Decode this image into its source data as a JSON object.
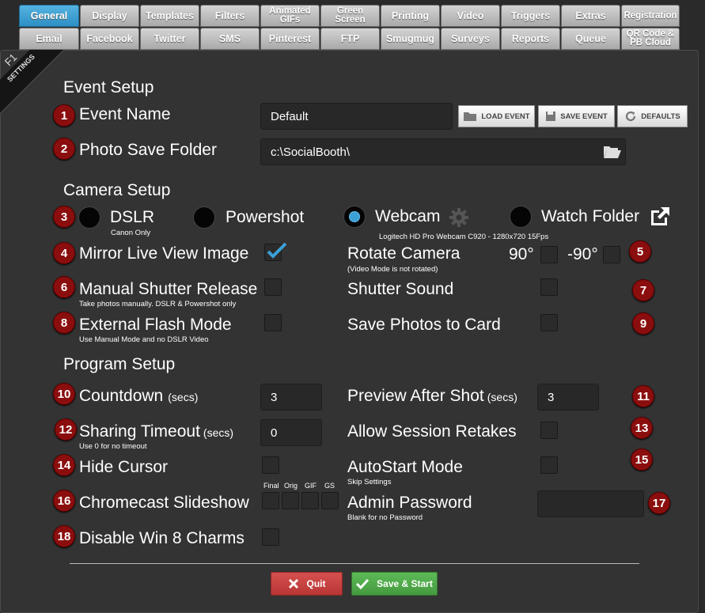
{
  "tabs_row1": [
    "General",
    "Display",
    "Templates",
    "Filters",
    "Animated GIFs",
    "Green Screen",
    "Printing",
    "Video",
    "Triggers",
    "Extras",
    "Registration"
  ],
  "tabs_row2": [
    "Email",
    "Facebook",
    "Twitter",
    "SMS",
    "Pinterest",
    "FTP",
    "Smugmug",
    "Surveys",
    "Reports",
    "Queue",
    "QR Code & PB Cloud"
  ],
  "ribbon": {
    "key": "F1",
    "label": "SETTINGS"
  },
  "sections": {
    "event": "Event Setup",
    "camera": "Camera Setup",
    "program": "Program Setup"
  },
  "event": {
    "name_label": "Event Name",
    "name_value": "Default",
    "folder_label": "Photo Save Folder",
    "folder_value": "c:\\SocialBooth\\",
    "load_btn": "LOAD EVENT",
    "save_btn": "SAVE EVENT",
    "defaults_btn": "DEFAULTS"
  },
  "camera": {
    "dslr": "DSLR",
    "dslr_sub": "Canon Only",
    "powershot": "Powershot",
    "webcam": "Webcam",
    "webcam_sub": "Logitech HD Pro Webcam C920 - 1280x720 15Fps",
    "watch": "Watch Folder",
    "selected": "Webcam"
  },
  "options": {
    "mirror": "Mirror Live View Image",
    "rotate": "Rotate Camera",
    "rotate_sub": "(Video Mode is not rotated)",
    "rot90": "90°",
    "rotneg90": "-90°",
    "manual": "Manual Shutter Release",
    "manual_sub": "Take photos manually.  DSLR & Powershot only",
    "shutter_sound": "Shutter Sound",
    "flash": "External Flash Mode",
    "flash_sub": "Use Manual Mode and no DSLR Video",
    "save_card": "Save Photos to Card"
  },
  "program": {
    "countdown": "Countdown",
    "countdown_unit": "(secs)",
    "countdown_value": "3",
    "preview": "Preview After Shot",
    "preview_unit": "(secs)",
    "preview_value": "3",
    "sharing": "Sharing Timeout",
    "sharing_unit": "(secs)",
    "sharing_value": "0",
    "sharing_sub": "Use 0 for no timeout",
    "retakes": "Allow Session Retakes",
    "hide_cursor": "Hide Cursor",
    "autostart": "AutoStart Mode",
    "autostart_sub": "Skip Settings",
    "chromecast": "Chromecast Slideshow",
    "cc_final": "Final",
    "cc_orig": "Orig",
    "cc_gif": "GIF",
    "cc_gs": "GS",
    "admin": "Admin Password",
    "admin_sub": "Blank for no Password",
    "win8": "Disable Win 8 Charms"
  },
  "badges": [
    "1",
    "2",
    "3",
    "4",
    "5",
    "6",
    "7",
    "8",
    "9",
    "10",
    "11",
    "12",
    "13",
    "14",
    "15",
    "16",
    "17",
    "18"
  ],
  "footer": {
    "quit": "Quit",
    "save_start": "Save & Start"
  },
  "colors": {
    "active_tab": "#3ba0d6",
    "badge": "#8b0e0e",
    "quit": "#c9403f",
    "save": "#4fa54a"
  }
}
